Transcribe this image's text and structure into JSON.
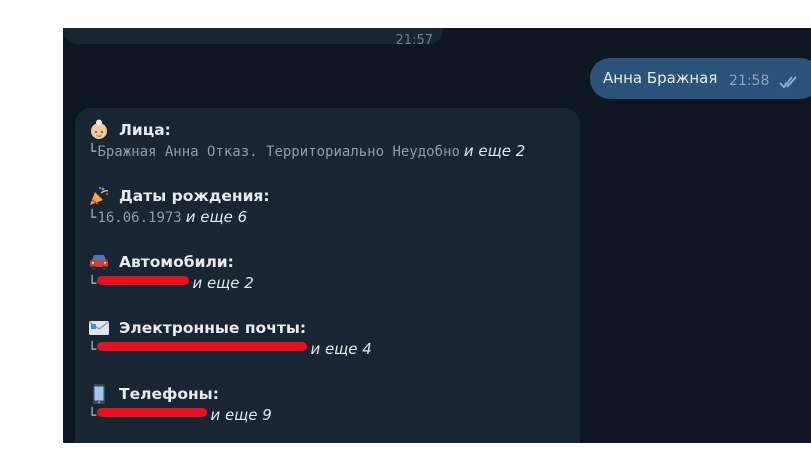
{
  "previous_message": {
    "time": "21:57"
  },
  "outgoing_message": {
    "text": "Анна Бражная",
    "time": "21:58",
    "status_icon": "double-check-icon"
  },
  "report": {
    "faces": {
      "icon": "elder-woman-emoji",
      "title": "Лица:",
      "value": "Бражная Анна Отказ. Территориально Неудобно",
      "more": "и еще 2"
    },
    "birthdays": {
      "icon": "party-popper-emoji",
      "title": "Даты рождения:",
      "value": "16.06.1973",
      "more": "и еще 6"
    },
    "cars": {
      "icon": "car-emoji",
      "title": "Автомобили:",
      "value": "",
      "more": "и еще 2"
    },
    "emails": {
      "icon": "email-emoji",
      "title": "Электронные почты:",
      "value": "",
      "more": "и еще 4"
    },
    "phones": {
      "icon": "mobile-phone-emoji",
      "title": "Телефоны:",
      "value": "",
      "more": "и еще 9"
    }
  },
  "colors": {
    "chat_bg": "#0e1621",
    "incoming_bubble": "#182533",
    "outgoing_bubble": "#2b5278",
    "redaction": "#e8101d"
  }
}
